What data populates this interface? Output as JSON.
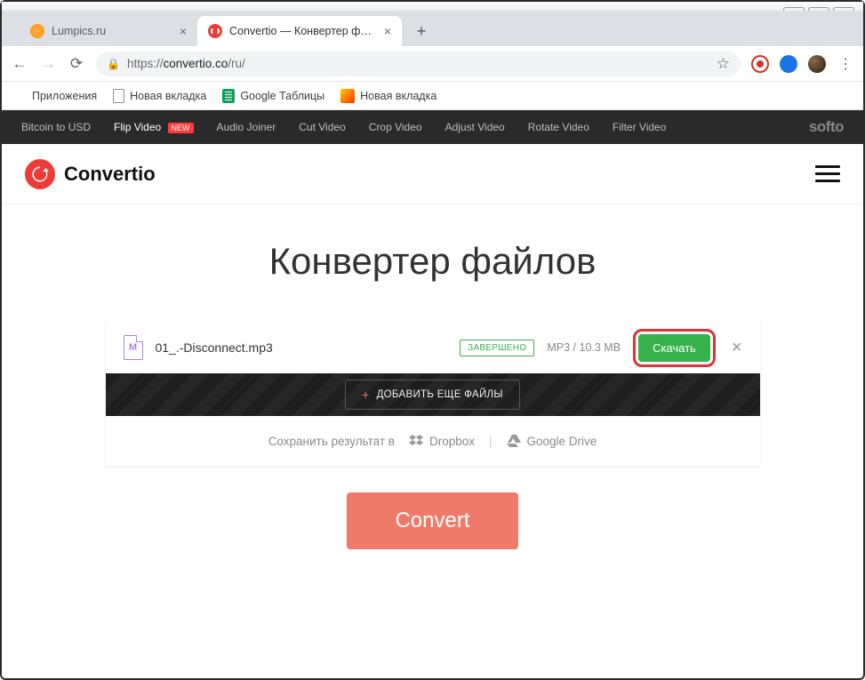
{
  "window": {
    "minimize": "—",
    "maximize": "□",
    "close": "✕"
  },
  "tabs": [
    {
      "title": "Lumpics.ru",
      "active": false
    },
    {
      "title": "Convertio — Конвертер файлов",
      "active": true
    }
  ],
  "toolbar": {
    "url_scheme": "https://",
    "url_host": "convertio.co",
    "url_path": "/ru/"
  },
  "bookmarks": {
    "apps": "Приложения",
    "items": [
      {
        "label": "Новая вкладка",
        "icon": "doc"
      },
      {
        "label": "Google Таблицы",
        "icon": "sheets"
      },
      {
        "label": "Новая вкладка",
        "icon": "ya"
      }
    ]
  },
  "softo": {
    "links": [
      {
        "label": "Bitcoin to USD",
        "hl": false
      },
      {
        "label": "Flip Video",
        "hl": true,
        "badge": "NEW"
      },
      {
        "label": "Audio Joiner",
        "hl": false
      },
      {
        "label": "Cut Video",
        "hl": false
      },
      {
        "label": "Crop Video",
        "hl": false
      },
      {
        "label": "Adjust Video",
        "hl": false
      },
      {
        "label": "Rotate Video",
        "hl": false
      },
      {
        "label": "Filter Video",
        "hl": false
      }
    ],
    "brand": "softo"
  },
  "header": {
    "logo_text": "Convertio"
  },
  "main": {
    "title": "Конвертер файлов",
    "file": {
      "icon_letter": "M",
      "name": "01_.-Disconnect.mp3",
      "status": "ЗАВЕРШЕНО",
      "meta": "MP3 / 10.3 MB",
      "download_label": "Скачать"
    },
    "add_more": "ДОБАВИТЬ ЕЩЕ ФАЙЛЫ",
    "save": {
      "prefix": "Сохранить результат в",
      "dropbox": "Dropbox",
      "gdrive": "Google Drive"
    },
    "convert": "Convert"
  }
}
